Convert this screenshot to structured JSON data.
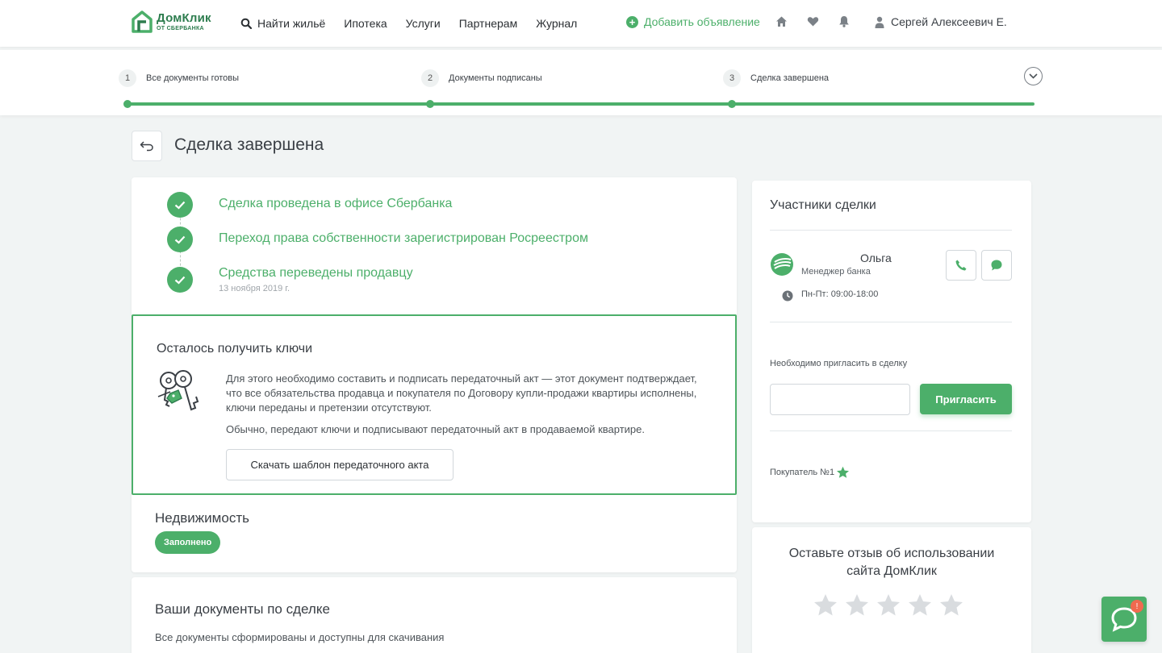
{
  "header": {
    "logo_main": "ДомКлик",
    "logo_sub": "ОТ СБЕРБАНКА",
    "nav": [
      {
        "label": "Найти жильё",
        "icon": "search-icon"
      },
      {
        "label": "Ипотека"
      },
      {
        "label": "Услуги"
      },
      {
        "label": "Партнерам"
      },
      {
        "label": "Журнал"
      }
    ],
    "add_listing": "Добавить объявление",
    "icons": [
      "home-icon",
      "heart-icon",
      "bell-icon"
    ],
    "user_name": "Сергей Алексеевич Е."
  },
  "steps": [
    {
      "num": "1",
      "label": "Все документы готовы"
    },
    {
      "num": "2",
      "label": "Документы подписаны"
    },
    {
      "num": "3",
      "label": "Сделка завершена"
    }
  ],
  "page_title": "Сделка завершена",
  "timeline": [
    {
      "text": "Сделка проведена в офисе Сбербанка"
    },
    {
      "text": "Переход права собственности зарегистрирован Росреестром"
    },
    {
      "text": "Средства переведены продавцу",
      "date": "13 ноября 2019 г."
    }
  ],
  "keys": {
    "title": "Осталось получить ключи",
    "paragraph1": "Для этого необходимо составить и подписать передаточный акт — этот документ подтверждает, что все обязательства продавца и покупателя по Договору купли-продажи квартиры исполнены, ключи переданы и претензии отсутствуют.",
    "paragraph2": "Обычно, передают ключи и подписывают передаточный акт в продаваемой квартире.",
    "download_button": "Скачать шаблон передаточного акта"
  },
  "property": {
    "title": "Недвижимость",
    "badge": "Заполнено"
  },
  "documents": {
    "title": "Ваши документы по сделке",
    "subtitle": "Все документы сформированы и доступны для скачивания"
  },
  "participants": {
    "title": "Участники сделки",
    "manager_name": "Ольга",
    "manager_role": "Менеджер банка",
    "hours": "Пн-Пт: 09:00-18:00",
    "invite_label": "Необходимо пригласить в сделку",
    "invite_value": "",
    "invite_button": "Пригласить",
    "buyer_label": "Покупатель №1"
  },
  "review": {
    "title_line1": "Оставьте отзыв об использовании",
    "title_line2": "сайта ДомКлик",
    "rating": 0,
    "max_rating": 5
  },
  "chat": {
    "badge": "!"
  },
  "colors": {
    "accent": "#4caf6a",
    "brand_dark": "#2e7d4f",
    "background": "#f1f4f4",
    "star_empty": "#d9dcdf",
    "badge_alert": "#f06a4f"
  }
}
